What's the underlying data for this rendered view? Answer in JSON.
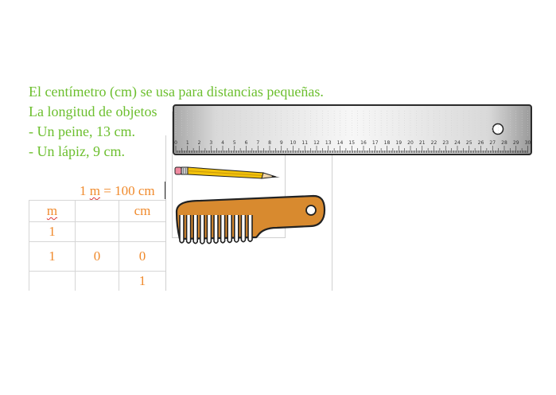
{
  "text": {
    "line1": "El centímetro (cm) se usa para distancias pequeñas.",
    "line2": "La longitud de objetos",
    "line3": "- Un peine, 13 cm.",
    "line4": "- Un lápiz, 9 cm."
  },
  "equation": {
    "prefix": "1 ",
    "unit": "m",
    "suffix": " = 100 cm"
  },
  "table": {
    "header": [
      "m",
      "",
      "cm"
    ],
    "rows": [
      [
        "1",
        "",
        ""
      ],
      [
        "1",
        "0",
        "0"
      ],
      [
        "",
        "",
        "1"
      ]
    ]
  },
  "ruler": {
    "tick_labels": [
      "0",
      "1",
      "2",
      "3",
      "4",
      "5",
      "6",
      "7",
      "8",
      "9",
      "10",
      "11",
      "12",
      "13",
      "14",
      "15",
      "16",
      "17",
      "18",
      "19",
      "20",
      "21",
      "22",
      "23",
      "24",
      "25",
      "26",
      "27",
      "28",
      "29",
      "30"
    ]
  },
  "icons": {
    "ruler": "ruler-icon",
    "pencil": "pencil-icon",
    "comb": "comb-icon"
  },
  "colors": {
    "text_green": "#6cbf2e",
    "text_orange": "#f08a2c",
    "comb_brown": "#d88a2f",
    "pencil_yellow": "#f2c20a"
  }
}
